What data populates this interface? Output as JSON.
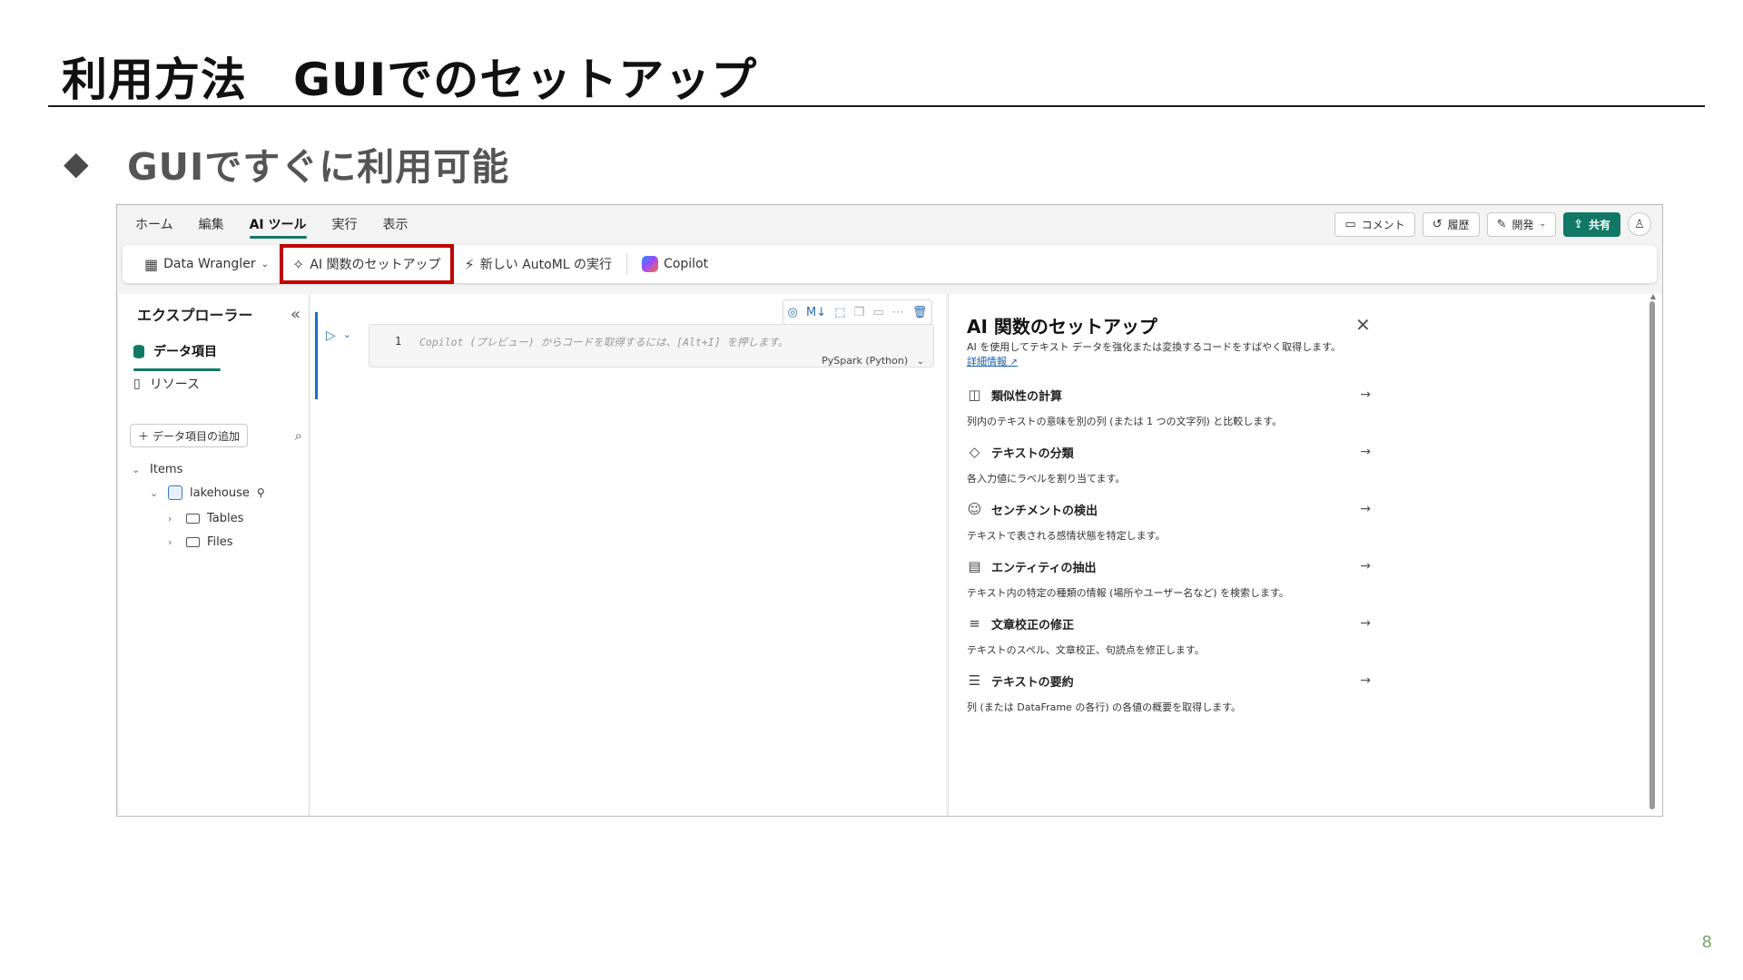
{
  "slide": {
    "title": "利用方法　GUIでのセットアップ",
    "bullet_glyph": "◆",
    "bullet_text": "GUIですぐに利用可能",
    "page_number": "8"
  },
  "app": {
    "menu_tabs": [
      "ホーム",
      "編集",
      "AI ツール",
      "実行",
      "表示"
    ],
    "active_tab": "AI ツール",
    "right_buttons": {
      "comment": "コメント",
      "history": "履歴",
      "develop": "開発",
      "share": "共有"
    },
    "ribbon": {
      "data_wrangler": "Data Wrangler",
      "ai_setup": "AI 関数のセットアップ",
      "automl": "新しい AutoML の実行",
      "copilot": "Copilot"
    },
    "colors": {
      "accent": "#117865",
      "highlight_box": "#c00000",
      "link": "#1b5fa8"
    }
  },
  "explorer": {
    "title": "エクスプローラー",
    "nav_data": "データ項目",
    "nav_resources": "リソース",
    "add_button": "データ項目の追加",
    "tree": {
      "items": "Items",
      "lakehouse": "lakehouse",
      "tables": "Tables",
      "files": "Files"
    }
  },
  "notebook": {
    "line_number": "1",
    "placeholder": "Copilot (プレビュー) からコードを取得するには、[Alt+I] を押します。",
    "language": "PySpark (Python)",
    "markdown_label": "M↓"
  },
  "panel": {
    "title": "AI 関数のセットアップ",
    "description": "AI を使用してテキスト データを強化または変換するコードをすばやく取得します。",
    "link": "詳細情報",
    "features": [
      {
        "icon": "similarity-icon",
        "title": "類似性の計算",
        "desc": "列内のテキストの意味を別の列 (または 1 つの文字列) と比較します。"
      },
      {
        "icon": "tag-icon",
        "title": "テキストの分類",
        "desc": "各入力値にラベルを割り当てます。"
      },
      {
        "icon": "sentiment-icon",
        "title": "センチメントの検出",
        "desc": "テキストで表される感情状態を特定します。"
      },
      {
        "icon": "document-icon",
        "title": "エンティティの抽出",
        "desc": "テキスト内の特定の種類の情報 (場所やユーザー名など) を検索します。"
      },
      {
        "icon": "proofread-icon",
        "title": "文章校正の修正",
        "desc": "テキストのスペル、文章校正、句読点を修正します。"
      },
      {
        "icon": "summary-icon",
        "title": "テキストの要約",
        "desc": "列 (または DataFrame の各行) の各値の概要を取得します。"
      }
    ]
  }
}
